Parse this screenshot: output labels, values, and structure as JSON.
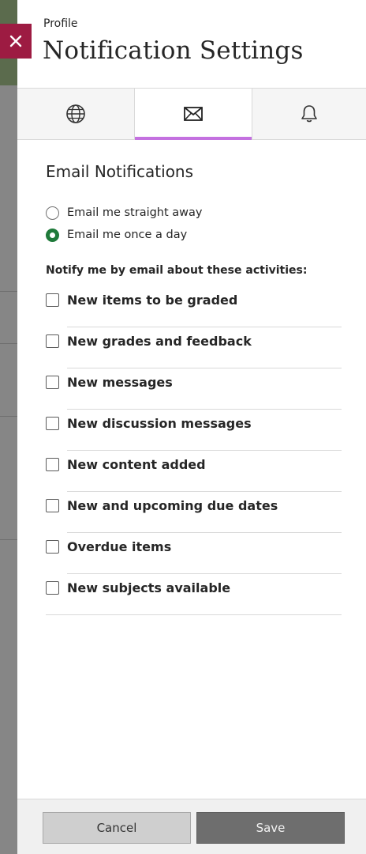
{
  "header": {
    "kicker": "Profile",
    "title": "Notification Settings"
  },
  "tabs": [
    {
      "icon": "globe-icon",
      "active": false
    },
    {
      "icon": "envelope-icon",
      "active": true
    },
    {
      "icon": "bell-icon",
      "active": false
    }
  ],
  "email": {
    "section_title": "Email Notifications",
    "frequency_options": [
      {
        "label": "Email me straight away",
        "selected": false
      },
      {
        "label": "Email me once a day",
        "selected": true
      }
    ],
    "activities_label": "Notify me by email about these activities:",
    "activities": [
      {
        "label": "New items to be graded",
        "checked": false
      },
      {
        "label": "New grades and feedback",
        "checked": false
      },
      {
        "label": "New messages",
        "checked": false
      },
      {
        "label": "New discussion messages",
        "checked": false
      },
      {
        "label": "New content added",
        "checked": false
      },
      {
        "label": "New and upcoming due dates",
        "checked": false
      },
      {
        "label": "Overdue items",
        "checked": false
      },
      {
        "label": "New subjects available",
        "checked": false
      }
    ]
  },
  "footer": {
    "cancel_label": "Cancel",
    "save_label": "Save"
  },
  "colors": {
    "close_tab": "#9d1b42",
    "active_tab_underline": "#c471e0",
    "radio_selected": "#1f7a3a"
  }
}
